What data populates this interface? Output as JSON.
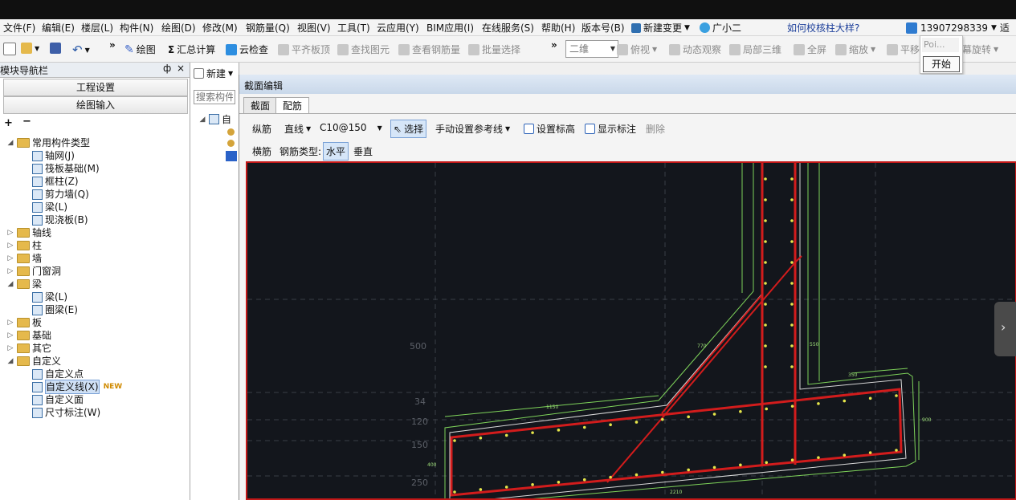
{
  "menu": [
    "文件(F)",
    "编辑(E)",
    "楼层(L)",
    "构件(N)",
    "绘图(D)",
    "修改(M)",
    "钢筋量(Q)",
    "视图(V)",
    "工具(T)",
    "云应用(Y)",
    "BIM应用(I)",
    "在线服务(S)",
    "帮助(H)",
    "版本号(B)",
    "新建变更",
    "广小二"
  ],
  "help_question": "如何校核柱大样?",
  "user_phone": "13907298339",
  "user_extra": "适",
  "toolbar": {
    "draw": "绘图",
    "sum_calc": "汇总计算",
    "cloud_check": "云检查",
    "align_top": "平齐板顶",
    "find_element": "查找图元",
    "view_rebar": "查看钢筋量",
    "batch_select": "批量选择",
    "view_mode": "二维",
    "top_view": "俯视",
    "dynamic_view": "动态观察",
    "local_3d": "局部三维",
    "fullscreen": "全屏",
    "zoom": "缩放",
    "pan": "平移",
    "screen_rotate": "幕旋转"
  },
  "popup": {
    "field": "Poi...",
    "start_button": "开始"
  },
  "nav": {
    "title": "模块导航栏",
    "pin": "ф",
    "close": "×",
    "project_settings": "工程设置",
    "drawing_input": "绘图输入",
    "tree": [
      {
        "label": "常用构件类型",
        "level": 0,
        "folder": true,
        "expanded": true
      },
      {
        "label": "轴网(J)",
        "level": 1
      },
      {
        "label": "筏板基础(M)",
        "level": 1
      },
      {
        "label": "框柱(Z)",
        "level": 1
      },
      {
        "label": "剪力墙(Q)",
        "level": 1
      },
      {
        "label": "梁(L)",
        "level": 1
      },
      {
        "label": "现浇板(B)",
        "level": 1
      },
      {
        "label": "轴线",
        "level": 0,
        "folder": true,
        "expanded": false
      },
      {
        "label": "柱",
        "level": 0,
        "folder": true,
        "expanded": false
      },
      {
        "label": "墙",
        "level": 0,
        "folder": true,
        "expanded": false
      },
      {
        "label": "门窗洞",
        "level": 0,
        "folder": true,
        "expanded": false
      },
      {
        "label": "梁",
        "level": 0,
        "folder": true,
        "expanded": true
      },
      {
        "label": "梁(L)",
        "level": 1
      },
      {
        "label": "圈梁(E)",
        "level": 1
      },
      {
        "label": "板",
        "level": 0,
        "folder": true,
        "expanded": false
      },
      {
        "label": "基础",
        "level": 0,
        "folder": true,
        "expanded": false
      },
      {
        "label": "其它",
        "level": 0,
        "folder": true,
        "expanded": false
      },
      {
        "label": "自定义",
        "level": 0,
        "folder": true,
        "expanded": true
      },
      {
        "label": "自定义点",
        "level": 1
      },
      {
        "label": "自定义线(X)",
        "level": 1,
        "badge": "NEW",
        "selected": true
      },
      {
        "label": "自定义面",
        "level": 1
      },
      {
        "label": "尺寸标注(W)",
        "level": 1
      }
    ]
  },
  "mid": {
    "new_button": "新建",
    "search_placeholder": "搜索构件",
    "tree_root": "自"
  },
  "dialog": {
    "title": "截面编辑",
    "tabs": [
      "截面",
      "配筋"
    ],
    "row1": {
      "longitudinal": "纵筋",
      "line_type": "直线",
      "rebar_spec": "C10@150",
      "select": "选择",
      "manual_ref": "手动设置参考线",
      "set_elevation": "设置标高",
      "show_annotation": "显示标注",
      "delete": "删除"
    },
    "row2": {
      "transverse": "横筋",
      "rebar_type_label": "钢筋类型:",
      "horizontal": "水平",
      "vertical": "垂直"
    }
  },
  "canvas": {
    "axis_labels": [
      "500",
      "34",
      "120",
      "150",
      "250"
    ],
    "dim_labels": [
      "770",
      "1150",
      "550",
      "350",
      "400",
      "900",
      "2210"
    ],
    "colors": {
      "background": "#13161c",
      "rebar": "#d21c1c",
      "outline": "#7ed35a",
      "points": "#e6e64a"
    }
  }
}
